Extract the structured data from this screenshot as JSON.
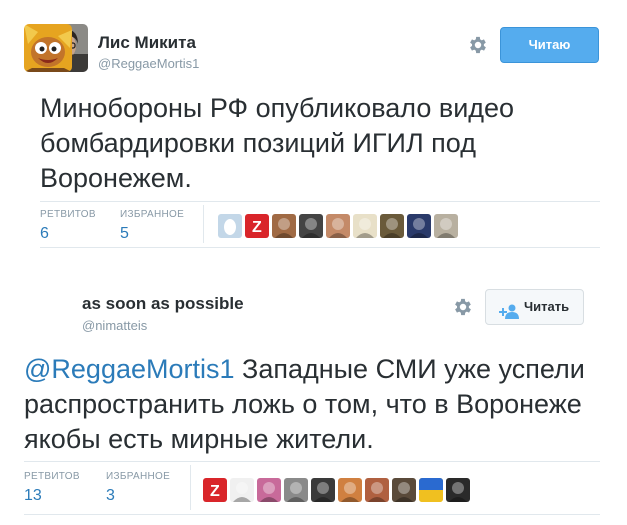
{
  "tweets": [
    {
      "name": "Лис Микита",
      "handle": "@ReggaeMortis1",
      "follow_label": "Читаю",
      "text": "Минобороны РФ опубликовало видео бомбардировки позиций ИГИЛ под Воронежем.",
      "retweets_label": "РЕТВИТОВ",
      "retweets": "6",
      "favorites_label": "ИЗБРАННОЕ",
      "favorites": "5",
      "avatar_icon": "avatar-photo-man-with-glasses",
      "favoriters": [
        {
          "icon": "egg-avatar",
          "color": "#c3d7e8"
        },
        {
          "icon": "z-letter-avatar",
          "color": "#d9252a"
        },
        {
          "icon": "curly-hair-avatar",
          "color": "#a06a44"
        },
        {
          "icon": "man-sketch-avatar",
          "color": "#444444"
        },
        {
          "icon": "man-face-avatar",
          "color": "#c48a68"
        },
        {
          "icon": "cartoon-figure-avatar",
          "color": "#e8e0c8"
        },
        {
          "icon": "painting-avatar",
          "color": "#6a5a3a"
        },
        {
          "icon": "man-suit-avatar",
          "color": "#2a3a6a"
        },
        {
          "icon": "cat-avatar",
          "color": "#b8b0a0"
        }
      ]
    },
    {
      "name": "as soon as possible",
      "handle": "@nimatteis",
      "follow_label": "Читать",
      "mention": "@ReggaeMortis1",
      "text": " Западные СМИ  уже успели распространить ложь о том, что в Воронеже якобы есть мирные жители.",
      "retweets_label": "РЕТВИТОВ",
      "retweets": "13",
      "favorites_label": "ИЗБРАННОЕ",
      "favorites": "3",
      "avatar_icon": "avatar-cartoon-character",
      "favoriters": [
        {
          "icon": "z-letter-avatar",
          "color": "#d9252a"
        },
        {
          "icon": "sketch-face-avatar",
          "color": "#f0f0f0"
        },
        {
          "icon": "grimace-avatar",
          "color": "#c86a9a"
        },
        {
          "icon": "grey-face-avatar",
          "color": "#8a8a8a"
        },
        {
          "icon": "dark-figure-avatar",
          "color": "#3a3a3a"
        },
        {
          "icon": "sunglasses-avatar",
          "color": "#d08040"
        },
        {
          "icon": "man-face-avatar",
          "color": "#b06040"
        },
        {
          "icon": "man-portrait-avatar",
          "color": "#5a4a3a"
        },
        {
          "icon": "yellow-blue-flag-avatar",
          "color": "#f0c020"
        },
        {
          "icon": "lion-avatar",
          "color": "#2a2a2a"
        }
      ]
    }
  ]
}
